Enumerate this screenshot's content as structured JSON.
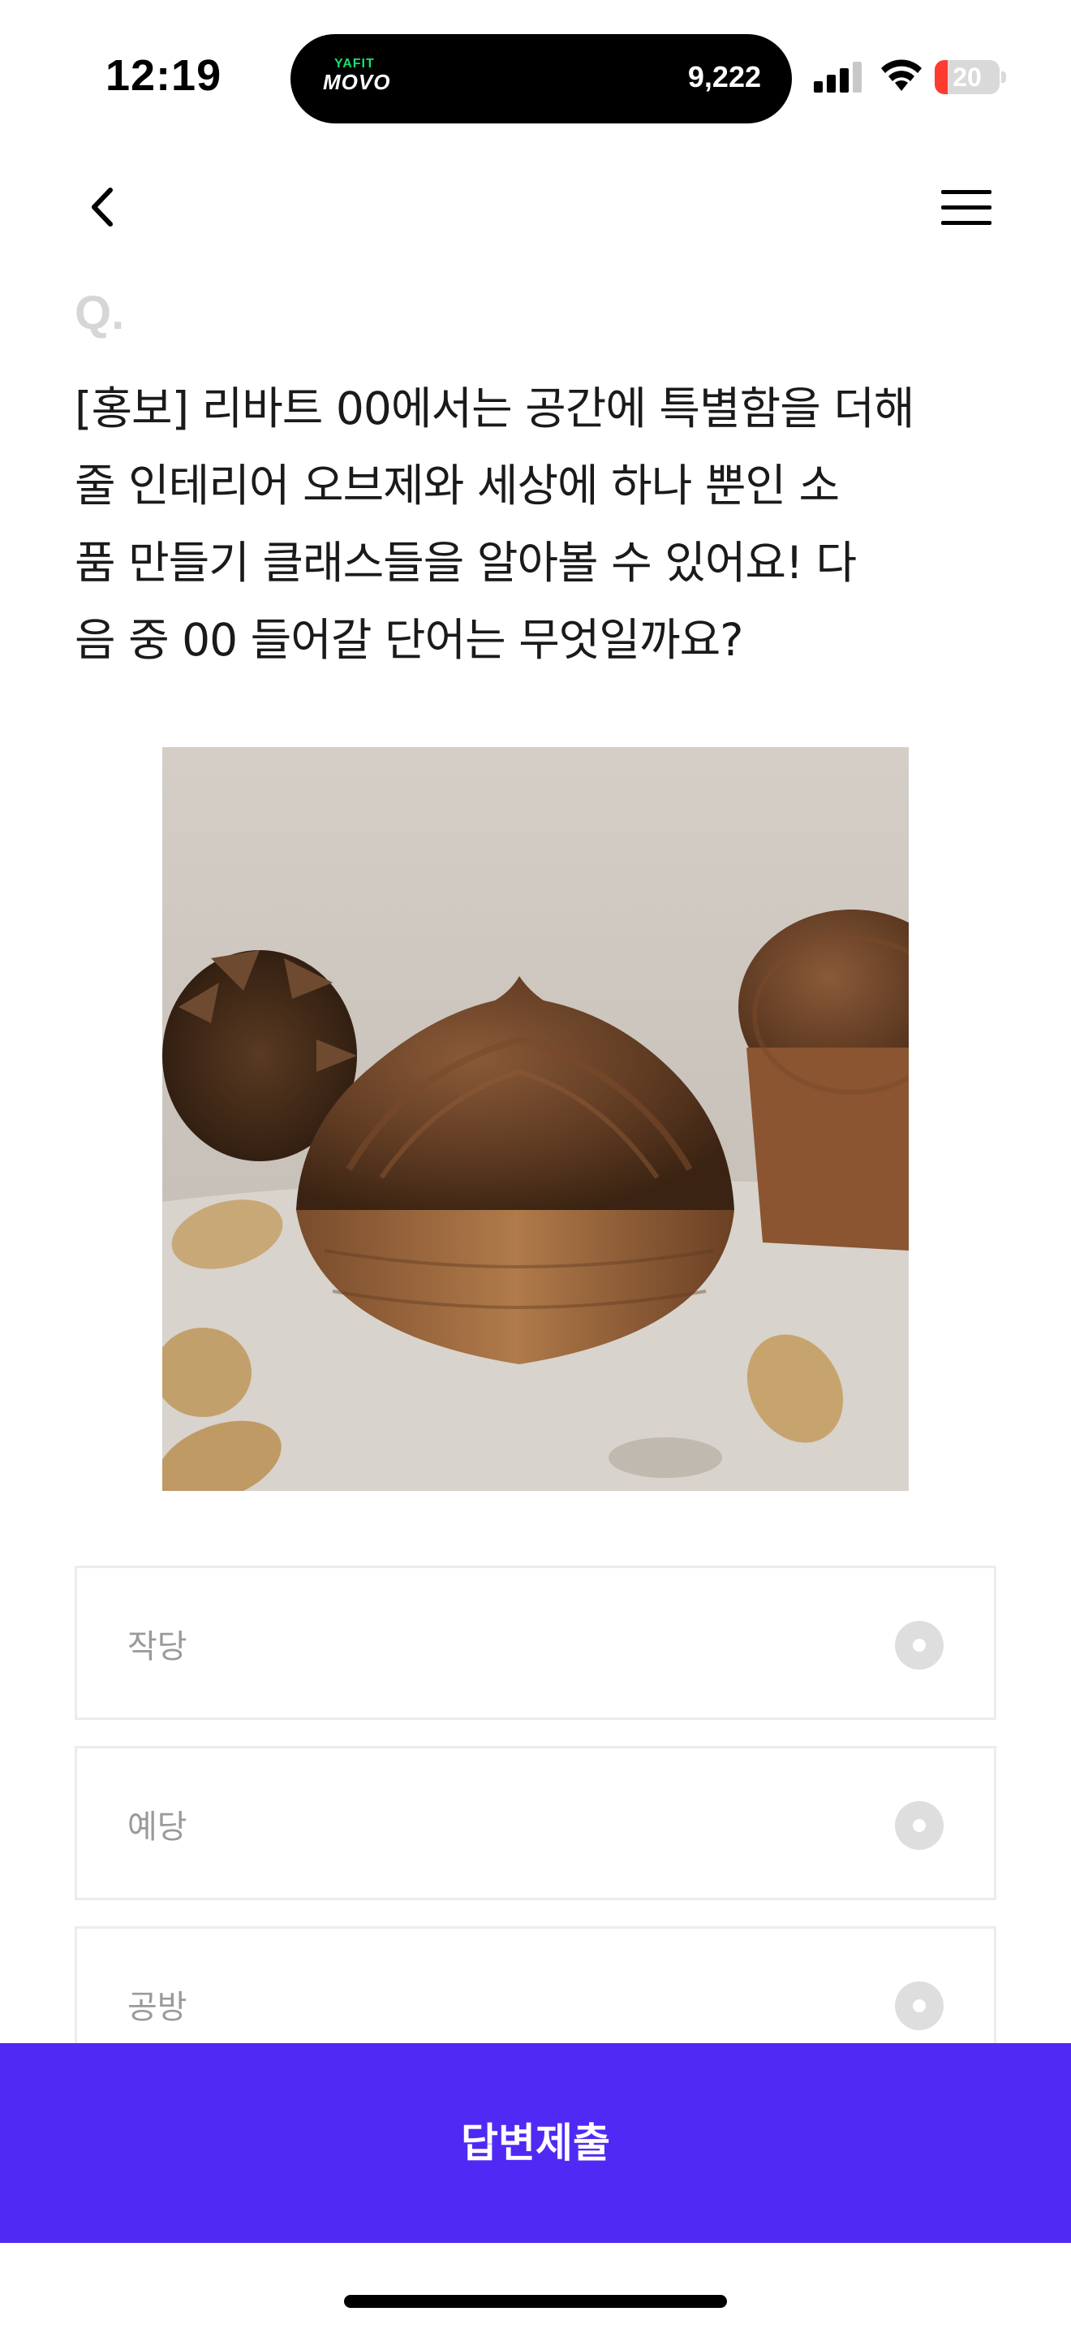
{
  "status_bar": {
    "time": "12:19",
    "island_brand_top": "YAFIT",
    "island_brand": "MOVO",
    "island_steps": "9,222",
    "battery_level": 20,
    "battery_text": "20",
    "battery_color": "#ff3b30"
  },
  "header": {
    "back_icon": "chevron-left-icon",
    "menu_icon": "hamburger-menu-icon"
  },
  "question": {
    "marker": "Q.",
    "lines": [
      "[홍보] 리바트 00에서는 공간에 특별함을 더해",
      "줄 인테리어 오브제와 세상에 하나 뿐인 소",
      "품 만들기 클래스들을 알아볼 수 있어요! 다",
      "음 중 00 들어갈 단어는 무엇일까요?"
    ]
  },
  "options": [
    {
      "label": "작당",
      "selected": false
    },
    {
      "label": "예당",
      "selected": false
    },
    {
      "label": "공방",
      "selected": false
    }
  ],
  "submit": {
    "label": "답변제출",
    "color": "#5029f5"
  }
}
